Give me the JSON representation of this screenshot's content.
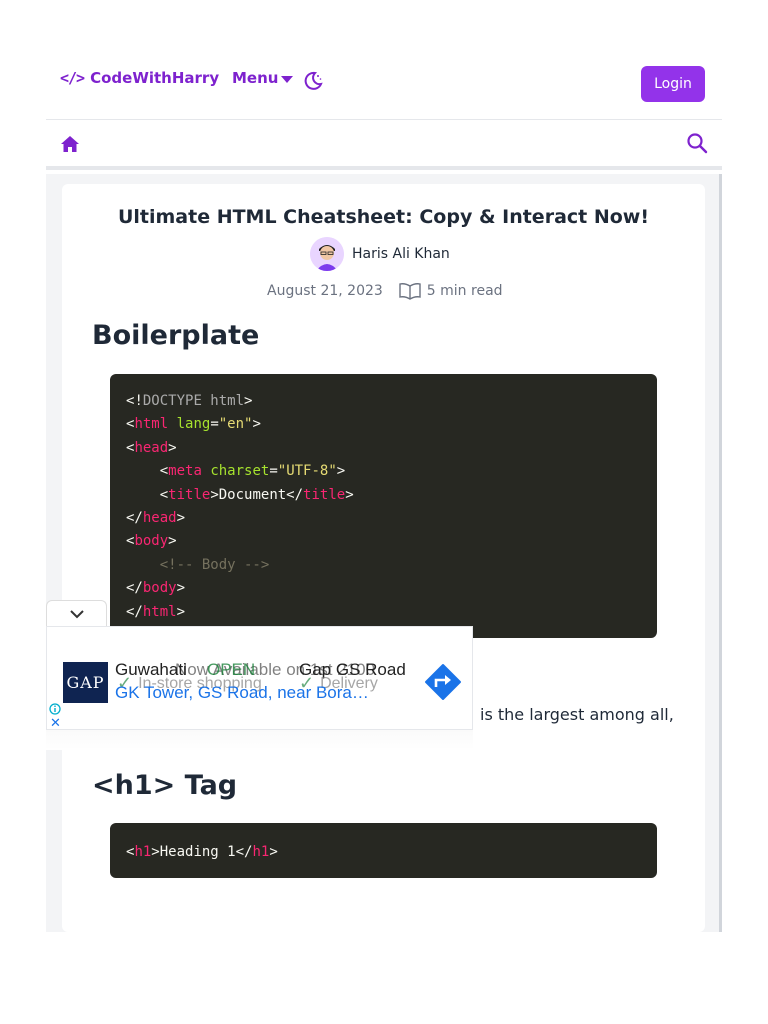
{
  "navbar": {
    "brand_icon": "</>",
    "brand_name": "CodeWithHarry",
    "menu_label": "Menu",
    "login_label": "Login"
  },
  "article": {
    "title": "Ultimate HTML Cheatsheet: Copy & Interact Now!",
    "author": "Haris Ali Khan",
    "date": "August 21, 2023",
    "read_time": "5 min read",
    "sections": [
      {
        "heading": "Boilerplate",
        "code": [
          "<!DOCTYPE html>",
          "<html lang=\"en\">",
          "<head>",
          "    <meta charset=\"UTF-8\">",
          "    <title>Document</title>",
          "</head>",
          "<body>",
          "    <!-- Body -->",
          "</body>",
          "</html>"
        ]
      },
      {
        "heading": "<h1> Tag",
        "code": [
          "<h1>Heading 1</h1>"
        ]
      }
    ],
    "paragraph_fragment": "is the largest among all,"
  },
  "ad": {
    "logo_text": "GAP",
    "line1_a": "Guwahati",
    "line1_b": "Now Available on 1st 2100",
    "status_open": "OPEN",
    "line1_c": "Gap GS Road",
    "line2": "GK Tower, GS Road, near Bora…",
    "feature_1": "In-store shopping",
    "feature_2": "Delivery"
  },
  "colors": {
    "brand": "#7e22ce",
    "login_bg": "#9333ea",
    "code_bg": "#272822"
  }
}
